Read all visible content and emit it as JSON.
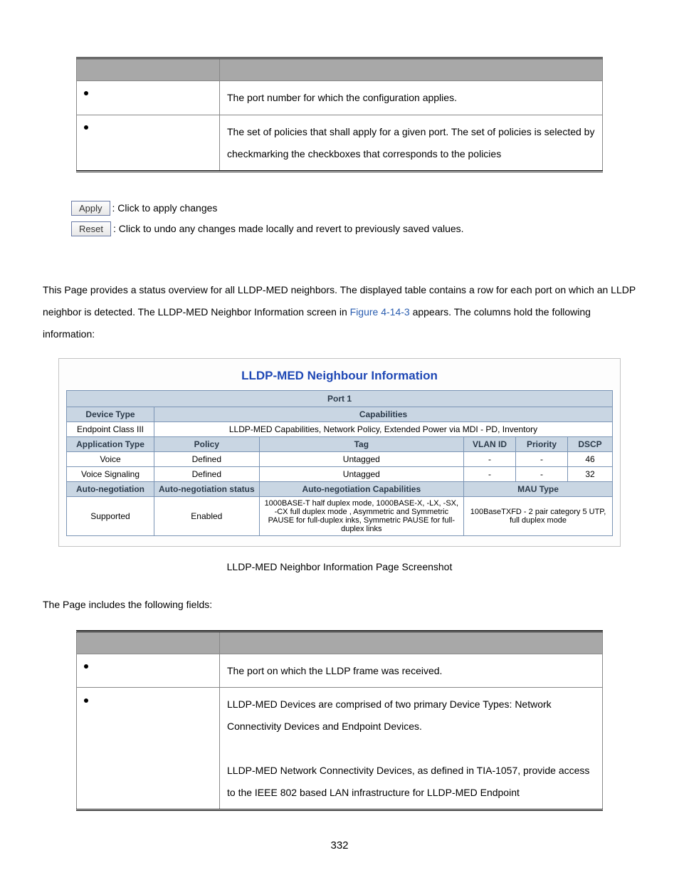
{
  "top_table": {
    "rows": [
      {
        "desc": "The port number for which the configuration applies."
      },
      {
        "desc": "The set of policies that shall apply for a given port. The set of policies is selected by checkmarking the checkboxes that corresponds to the policies"
      }
    ]
  },
  "buttons": {
    "apply": {
      "label": "Apply",
      "desc": ": Click to apply changes"
    },
    "reset": {
      "label": "Reset",
      "desc": ": Click to undo any changes made locally and revert to previously saved values."
    }
  },
  "intro": {
    "pre": "This Page provides a status overview for all LLDP-MED neighbors. The displayed table contains a row for each port on which an LLDP neighbor is detected. The LLDP-MED Neighbor Information screen in ",
    "figref": "Figure 4-14-3",
    "post": " appears. The columns hold the following information:"
  },
  "shot": {
    "title": "LLDP-MED Neighbour Information",
    "port": "Port 1",
    "row_devtype": {
      "h": "Device Type",
      "caps_h": "Capabilities"
    },
    "row_devtype_v": {
      "v": "Endpoint Class III",
      "caps_v": "LLDP-MED Capabilities, Network Policy, Extended Power via MDI - PD, Inventory"
    },
    "row_app_h": {
      "c1": "Application Type",
      "c2": "Policy",
      "c3": "Tag",
      "c4": "VLAN ID",
      "c5": "Priority",
      "c6": "DSCP"
    },
    "app_rows": [
      {
        "c1": "Voice",
        "c2": "Defined",
        "c3": "Untagged",
        "c4": "-",
        "c5": "-",
        "c6": "46"
      },
      {
        "c1": "Voice Signaling",
        "c2": "Defined",
        "c3": "Untagged",
        "c4": "-",
        "c5": "-",
        "c6": "32"
      }
    ],
    "row_auto_h": {
      "c1": "Auto-negotiation",
      "c2": "Auto-negotiation status",
      "c3": "Auto-negotiation Capabilities",
      "c4": "MAU Type"
    },
    "row_auto_v": {
      "c1": "Supported",
      "c2": "Enabled",
      "c3": "1000BASE-T half duplex mode, 1000BASE-X, -LX, -SX, -CX full duplex mode , Asymmetric and Symmetric PAUSE for full-duplex inks, Symmetric PAUSE for full-duplex links",
      "c4": "100BaseTXFD - 2 pair category 5 UTP, full duplex mode"
    }
  },
  "caption": "LLDP-MED Neighbor Information Page Screenshot",
  "fields_intro": "The Page includes the following fields:",
  "bottom_table": {
    "rows": [
      {
        "desc": "The port on which the LLDP frame was received."
      },
      {
        "desc": "LLDP-MED Devices are comprised of two primary Device Types: Network Connectivity Devices and Endpoint Devices.",
        "desc2": "LLDP-MED Network Connectivity Devices, as defined in TIA-1057, provide access to the IEEE 802 based LAN infrastructure for LLDP-MED Endpoint"
      }
    ]
  },
  "page_num": "332"
}
